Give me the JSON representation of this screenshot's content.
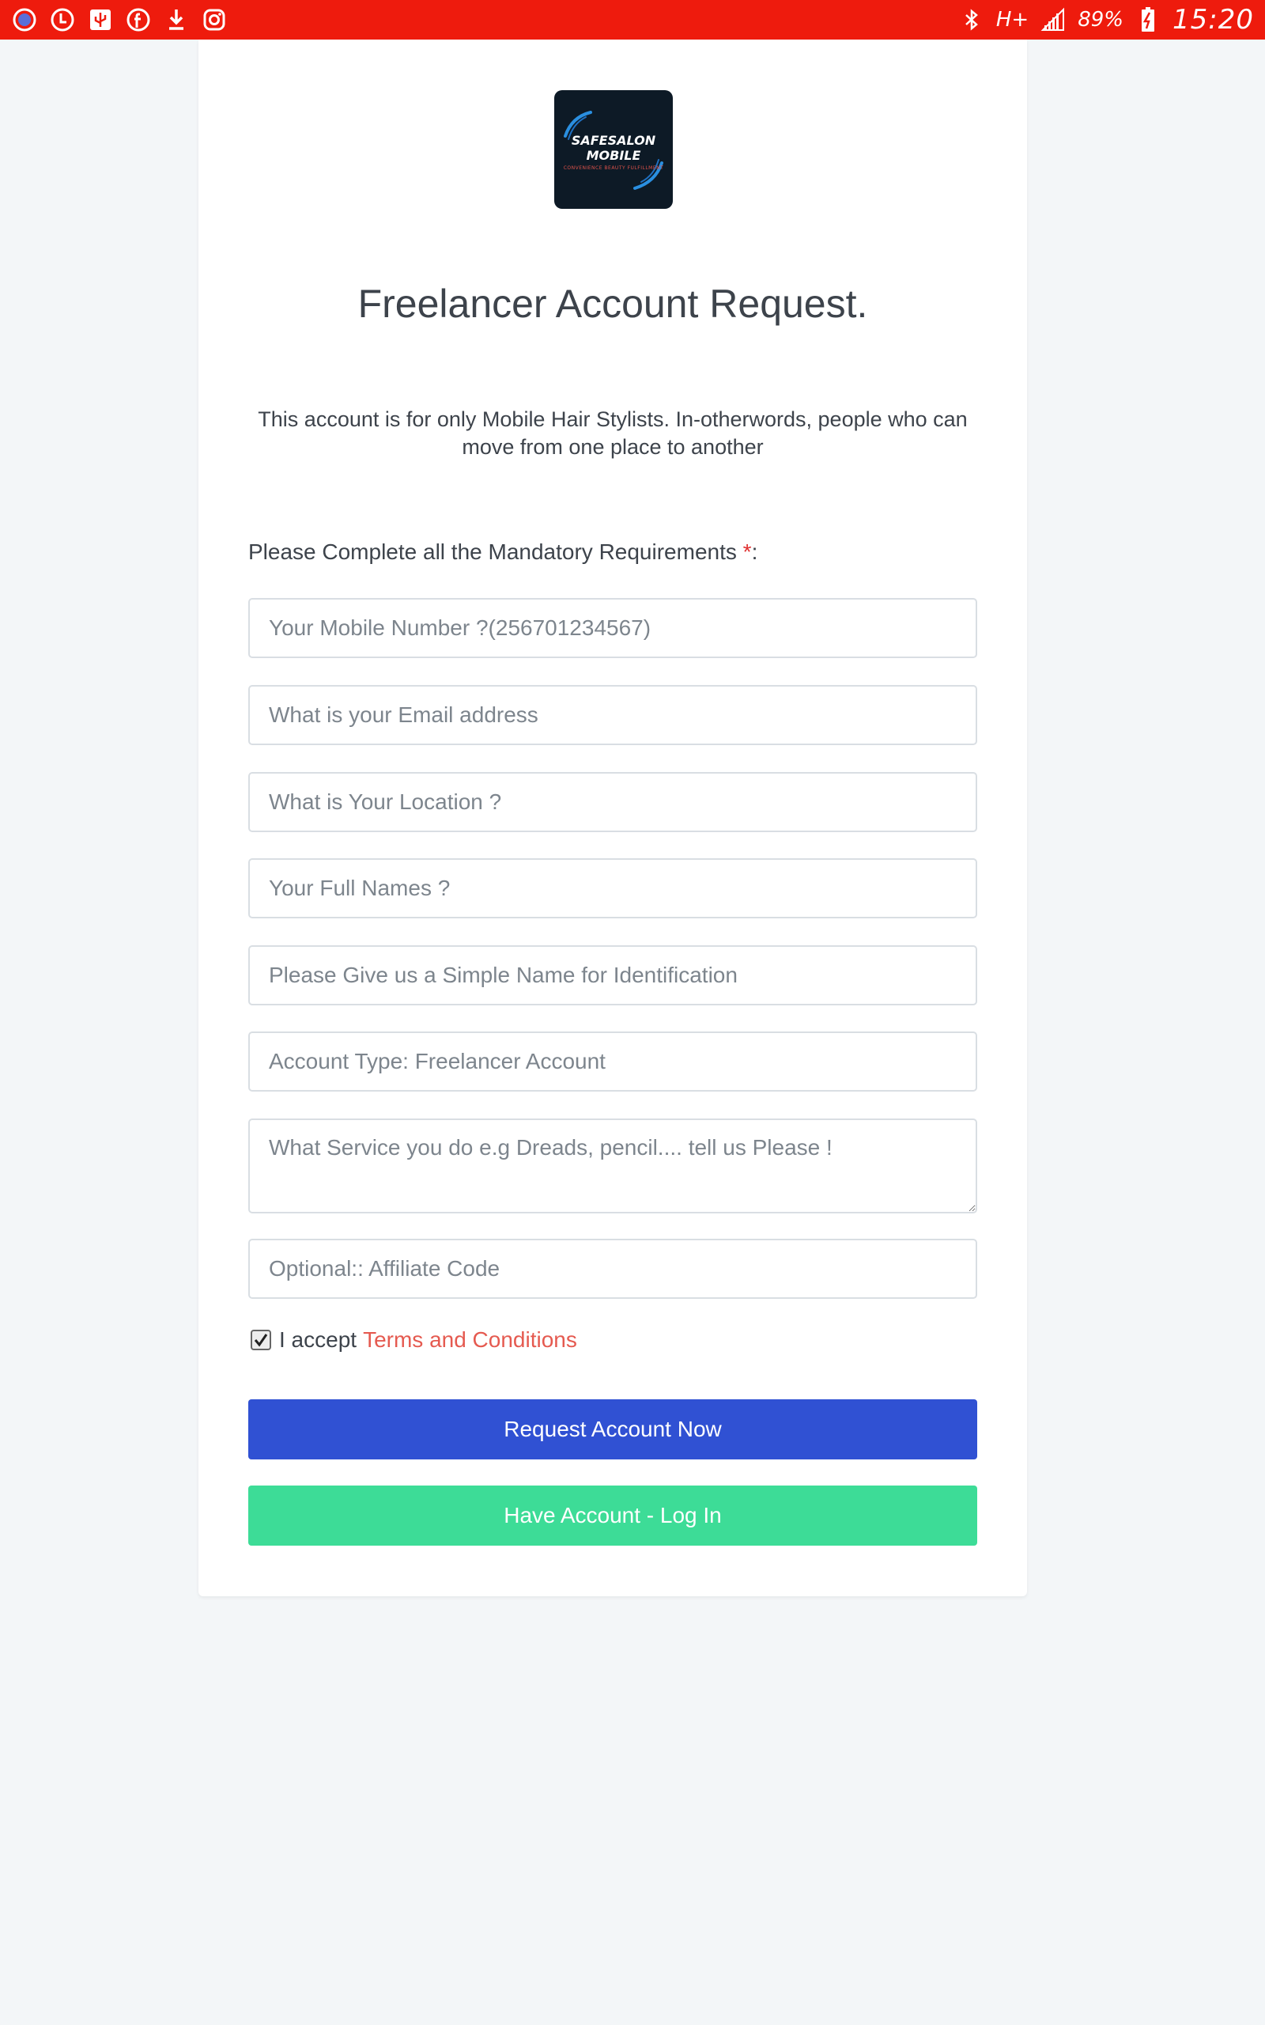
{
  "status_bar": {
    "icons_left": [
      "chat-icon",
      "clock-app-icon",
      "usb-icon",
      "facebook-icon",
      "download-icon",
      "instagram-icon"
    ],
    "network": "H+",
    "battery": "89%",
    "time": "15:20"
  },
  "logo": {
    "line1": "SAFESALON",
    "line2": "MOBILE",
    "tagline": "CONVENIENCE BEAUTY FULFILLMENT"
  },
  "page": {
    "title": "Freelancer Account Request.",
    "intro": "This account is for only Mobile Hair Stylists. In-otherwords, people who can move from one place to another",
    "mandatory_label": "Please Complete all the Mandatory Requirements ",
    "mandatory_star": "*",
    "mandatory_colon": ":"
  },
  "form": {
    "mobile_placeholder": "Your Mobile Number ?(256701234567)",
    "email_placeholder": "What is your Email address",
    "location_placeholder": "What is Your Location ?",
    "fullname_placeholder": "Your Full Names ?",
    "simplename_placeholder": "Please Give us a Simple Name for Identification",
    "account_type_placeholder": "Account Type: Freelancer Account",
    "service_placeholder": "What Service you do e.g Dreads, pencil.... tell us Please !",
    "affiliate_placeholder": "Optional:: Affiliate Code",
    "accept_text": "I accept",
    "terms_link": "Terms and Conditions",
    "accept_checked": true,
    "request_button": "Request Account Now",
    "login_button": "Have Account - Log In"
  },
  "colors": {
    "status_bar": "#ee1b0d",
    "primary_button": "#3051d3",
    "success_button": "#3ddc97",
    "link": "#e55a50",
    "required_star": "#e03131"
  }
}
